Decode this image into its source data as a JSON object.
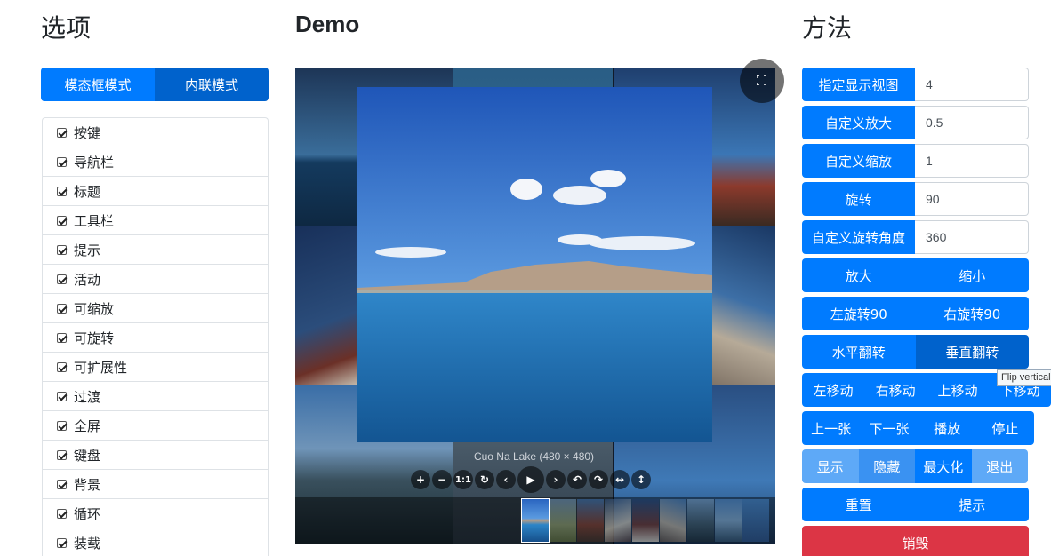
{
  "options": {
    "heading": "选项",
    "modes": [
      "模态框模式",
      "内联模式"
    ],
    "items": [
      "按键",
      "导航栏",
      "标题",
      "工具栏",
      "提示",
      "活动",
      "可缩放",
      "可旋转",
      "可扩展性",
      "过渡",
      "全屏",
      "键盘",
      "背景",
      "循环",
      "装载"
    ]
  },
  "demo": {
    "heading": "Demo",
    "caption": "Cuo Na Lake (480 × 480)",
    "toolbar": {
      "zoom_in": "+",
      "zoom_out": "−",
      "one_to_one": "1:1",
      "reset": "↻",
      "prev": "‹",
      "play": "▶",
      "next": "›",
      "rotate_left": "↶",
      "rotate_right": "↷",
      "flip_h": "↔",
      "flip_v": "↕"
    }
  },
  "methods": {
    "heading": "方法",
    "inputs": [
      {
        "label": "指定显示视图",
        "value": "4"
      },
      {
        "label": "自定义放大",
        "value": "0.5"
      },
      {
        "label": "自定义缩放",
        "value": "1"
      },
      {
        "label": "旋转",
        "value": "90"
      },
      {
        "label": "自定义旋转角度",
        "value": "360"
      }
    ],
    "zoom": [
      "放大",
      "缩小"
    ],
    "rotate": [
      "左旋转90",
      "右旋转90"
    ],
    "flip": [
      "水平翻转",
      "垂直翻转"
    ],
    "move": [
      "左移动",
      "右移动",
      "上移动",
      "下移动"
    ],
    "nav": [
      "上一张",
      "下一张",
      "播放",
      "停止"
    ],
    "state": [
      "显示",
      "隐藏",
      "最大化",
      "退出"
    ],
    "misc": [
      "重置",
      "提示"
    ],
    "destroy": "销毁",
    "tooltip": "Flip vertical"
  }
}
